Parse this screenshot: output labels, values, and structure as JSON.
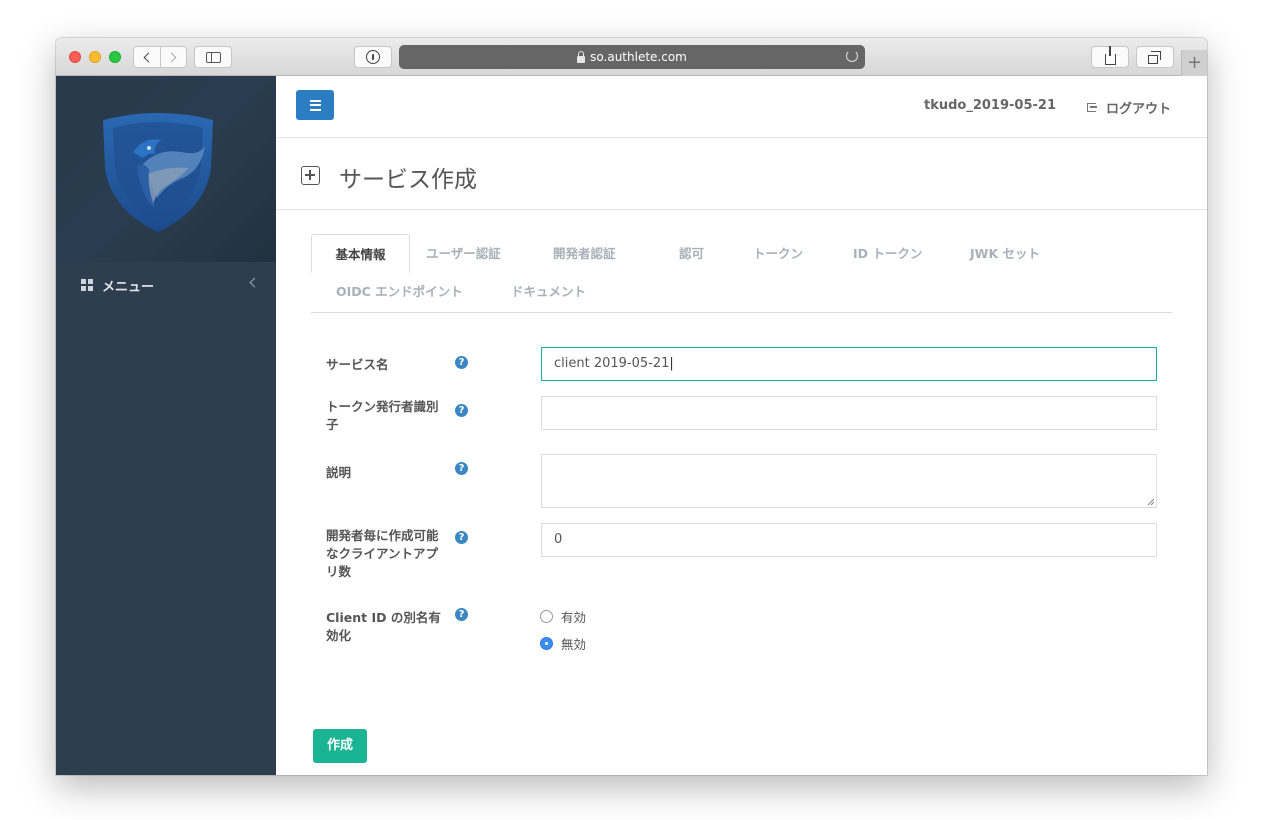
{
  "browser": {
    "url": "so.authlete.com"
  },
  "header": {
    "username": "tkudo_2019-05-21",
    "logout_label": "ログアウト"
  },
  "sidebar": {
    "menu_label": "メニュー"
  },
  "page": {
    "title": "サービス作成"
  },
  "tabs": [
    {
      "label": "基本情報",
      "active": true
    },
    {
      "label": "ユーザー認証"
    },
    {
      "label": "開発者認証"
    },
    {
      "label": "認可"
    },
    {
      "label": "トークン"
    },
    {
      "label": "ID トークン"
    },
    {
      "label": "JWK セット"
    },
    {
      "label": "OIDC エンドポイント"
    },
    {
      "label": "ドキュメント"
    }
  ],
  "form": {
    "service_name": {
      "label": "サービス名",
      "value": "client 2019-05-21"
    },
    "issuer": {
      "label": "トークン発行者識別子",
      "value": ""
    },
    "description": {
      "label": "説明",
      "value": ""
    },
    "client_limit": {
      "label": "開発者毎に作成可能なクライアントアプリ数",
      "value": "0"
    },
    "client_id_alias": {
      "label": "Client ID の別名有効化",
      "options": [
        {
          "label": "有効",
          "checked": false
        },
        {
          "label": "無効",
          "checked": true
        }
      ]
    },
    "help_symbol": "?",
    "submit_label": "作成"
  },
  "colors": {
    "primary": "#2a7dc0",
    "accent": "#1ab394",
    "sidebar": "#2e3e4f"
  }
}
